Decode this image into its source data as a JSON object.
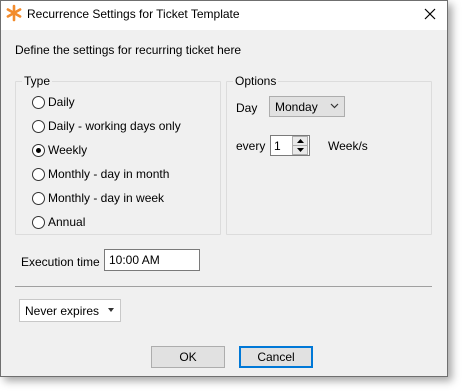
{
  "window": {
    "title": "Recurrence Settings for Ticket Template",
    "accent_color": "#f28b2c"
  },
  "description": "Define the settings for recurring ticket here",
  "type_group": {
    "legend": "Type",
    "options": [
      {
        "label": "Daily",
        "checked": false
      },
      {
        "label": "Daily - working days only",
        "checked": false
      },
      {
        "label": "Weekly",
        "checked": true
      },
      {
        "label": "Monthly - day in month",
        "checked": false
      },
      {
        "label": "Monthly - day in week",
        "checked": false
      },
      {
        "label": "Annual",
        "checked": false
      }
    ]
  },
  "options_group": {
    "legend": "Options",
    "day_label": "Day",
    "day_value": "Monday",
    "every_label": "every",
    "every_value": "1",
    "unit_label": "Week/s"
  },
  "execution": {
    "label": "Execution time",
    "value": "10:00 AM"
  },
  "expiry": {
    "value": "Never expires"
  },
  "footer": {
    "ok_label": "OK",
    "cancel_label": "Cancel"
  }
}
